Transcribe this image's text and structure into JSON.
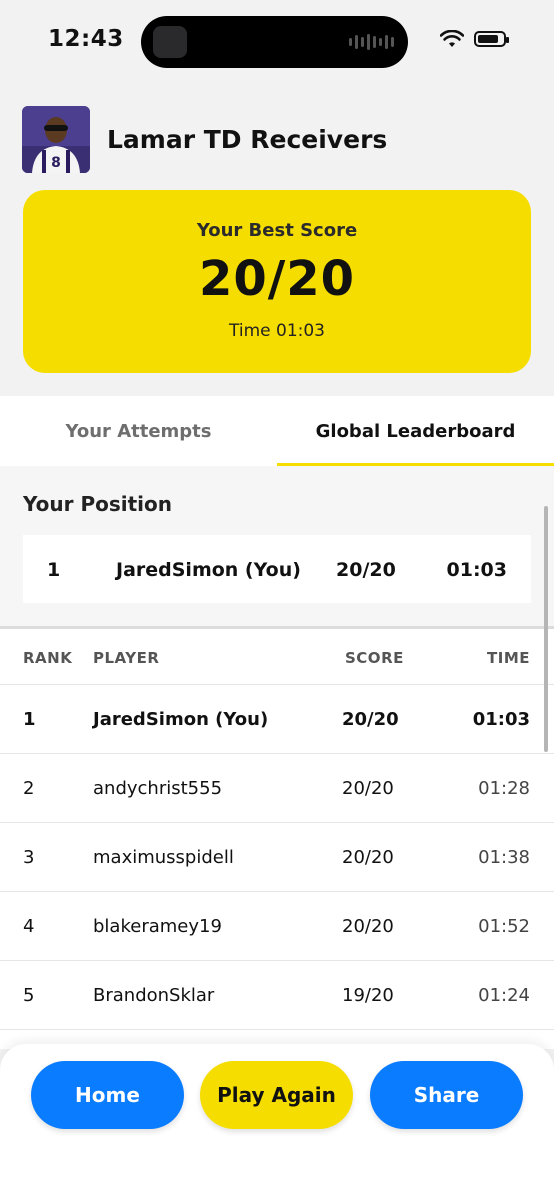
{
  "status_bar": {
    "time": "12:43"
  },
  "header": {
    "title": "Lamar TD Receivers",
    "avatar_jersey_number": "8"
  },
  "best_score": {
    "label": "Your Best Score",
    "score": "20/20",
    "time": "Time 01:03"
  },
  "tabs": [
    {
      "label": "Your Attempts",
      "active": false
    },
    {
      "label": "Global Leaderboard",
      "active": true
    }
  ],
  "your_position": {
    "title": "Your Position",
    "rank": "1",
    "player": "JaredSimon (You)",
    "score": "20/20",
    "time": "01:03"
  },
  "leaderboard": {
    "columns": {
      "rank": "RANK",
      "player": "PLAYER",
      "score": "SCORE",
      "time": "TIME"
    },
    "rows": [
      {
        "rank": "1",
        "player": "JaredSimon (You)",
        "score": "20/20",
        "time": "01:03"
      },
      {
        "rank": "2",
        "player": "andychrist555",
        "score": "20/20",
        "time": "01:28"
      },
      {
        "rank": "3",
        "player": "maximusspidell",
        "score": "20/20",
        "time": "01:38"
      },
      {
        "rank": "4",
        "player": "blakeramey19",
        "score": "20/20",
        "time": "01:52"
      },
      {
        "rank": "5",
        "player": "BrandonSklar",
        "score": "19/20",
        "time": "01:24"
      }
    ]
  },
  "actions": {
    "home": "Home",
    "play_again": "Play Again",
    "share": "Share"
  },
  "colors": {
    "accent_yellow": "#f5dd00",
    "accent_blue": "#0a7cff"
  }
}
